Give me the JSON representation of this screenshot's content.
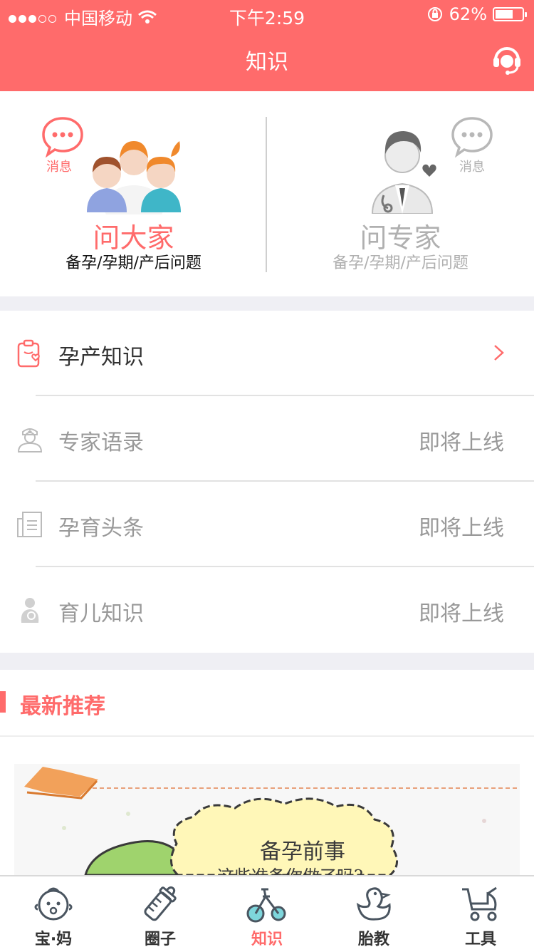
{
  "status_bar": {
    "carrier": "中国移动",
    "time": "下午2:59",
    "battery": "62%",
    "battery_level": 0.62,
    "signal_bars": 3,
    "signal_total": 5
  },
  "navbar": {
    "title": "知识",
    "service_icon": "customer-service-icon"
  },
  "ask": {
    "left": {
      "msg": "消息",
      "name": "问大家",
      "sub": "备孕/孕期/产后问题"
    },
    "right": {
      "msg": "消息",
      "name": "问专家",
      "sub": "备孕/孕期/产后问题"
    }
  },
  "list": [
    {
      "label": "孕产知识",
      "right": "",
      "icon": "clipboard-heart-icon"
    },
    {
      "label": "专家语录",
      "right": "即将上线",
      "icon": "nurse-icon"
    },
    {
      "label": "孕育头条",
      "right": "即将上线",
      "icon": "newspaper-icon"
    },
    {
      "label": "育儿知识",
      "right": "即将上线",
      "icon": "mother-baby-icon"
    }
  ],
  "recommend": {
    "title": "最新推荐"
  },
  "banner": {
    "line1": "备孕前事",
    "line2": "这些准备你做了吗?"
  },
  "tabs": [
    {
      "label": "宝·妈",
      "icon": "baby-face-icon"
    },
    {
      "label": "圈子",
      "icon": "baby-bottle-icon"
    },
    {
      "label": "知识",
      "icon": "tricycle-icon"
    },
    {
      "label": "胎教",
      "icon": "duck-icon"
    },
    {
      "label": "工具",
      "icon": "stroller-icon"
    }
  ],
  "colors": {
    "accent": "#ff6b6b",
    "muted": "#999999",
    "separator": "#efeff4"
  }
}
